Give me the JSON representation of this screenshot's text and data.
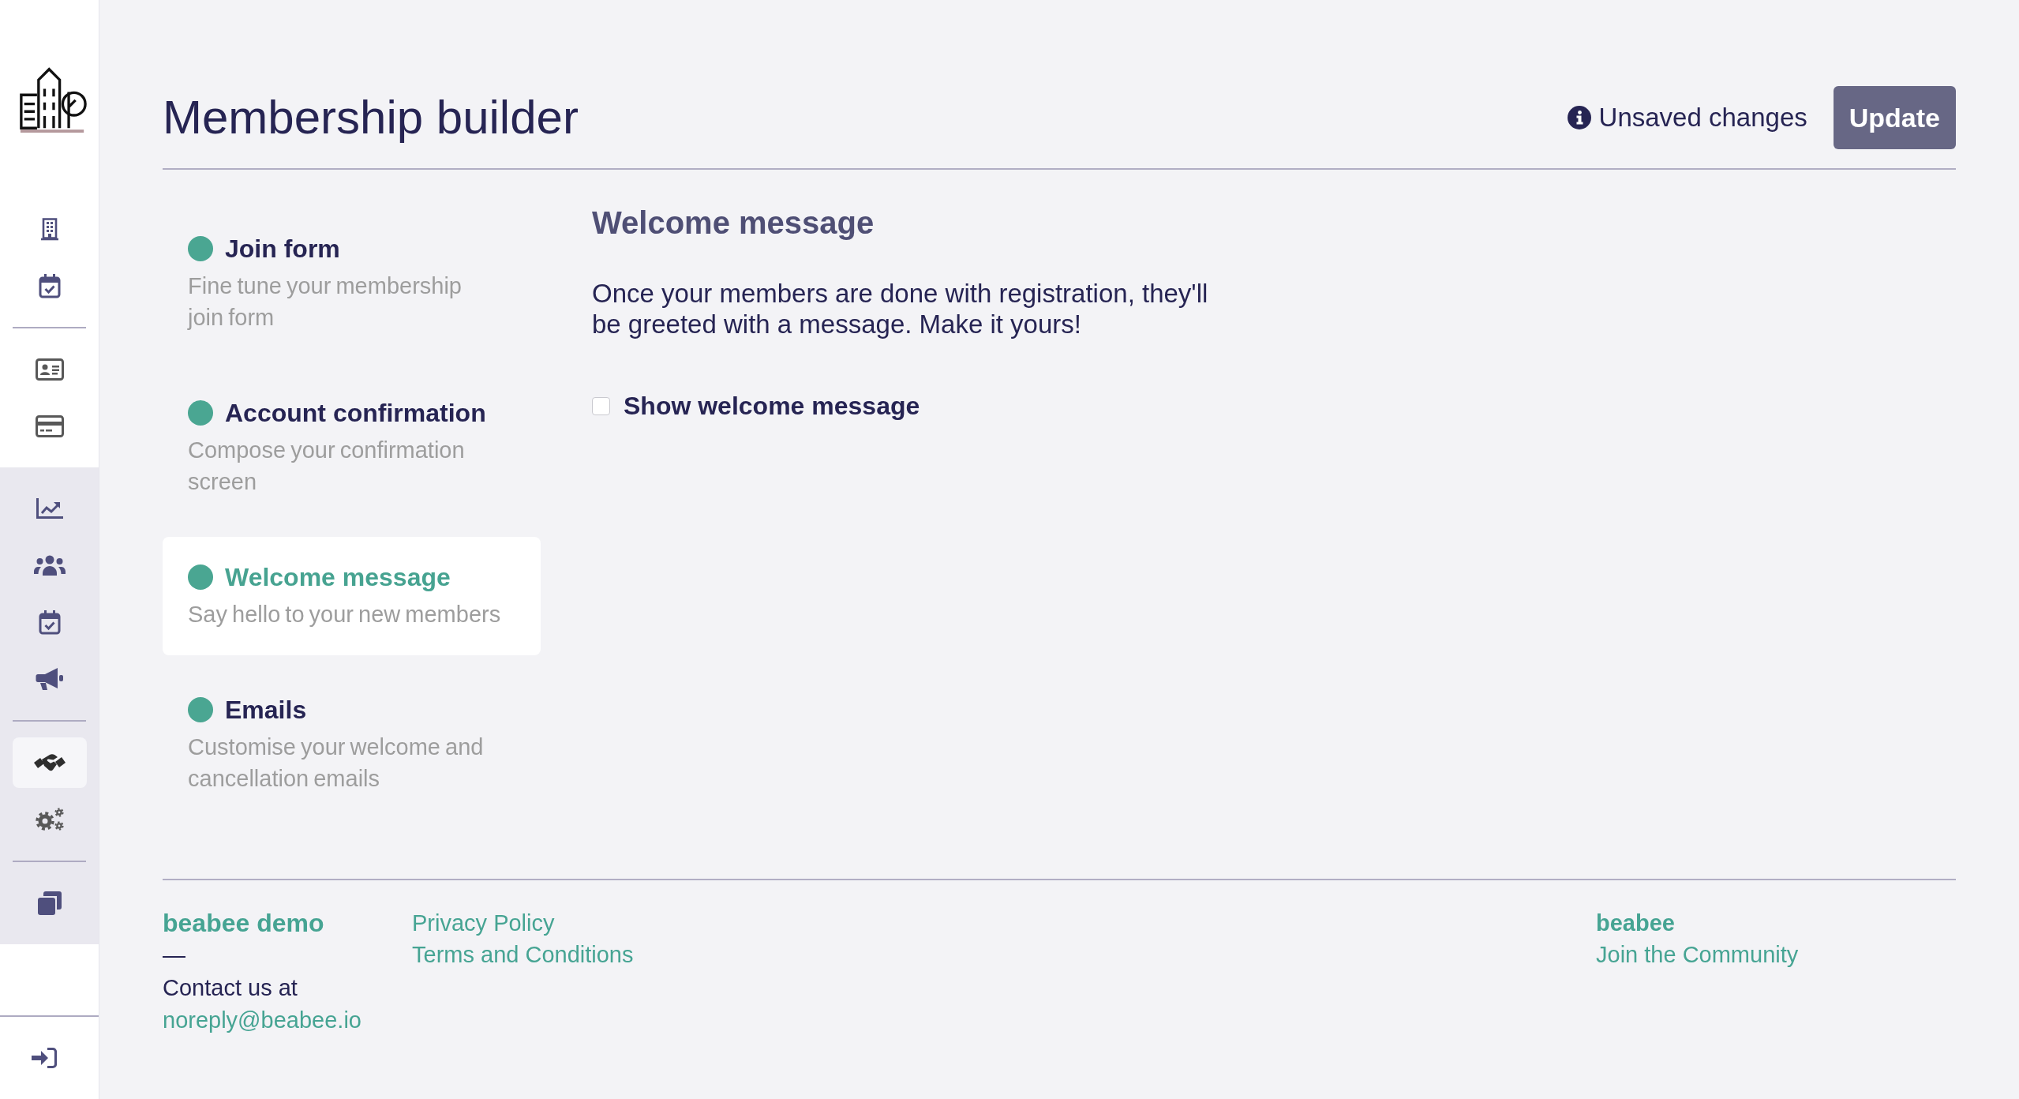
{
  "sidebar": {
    "sections": [
      {
        "shaded": false,
        "items": [
          {
            "selected": false
          },
          {
            "selected": false
          }
        ]
      },
      {
        "shaded": false,
        "items": [
          {
            "selected": false
          },
          {
            "selected": false
          }
        ]
      },
      {
        "shaded": true,
        "items": [
          {
            "selected": false
          },
          {
            "selected": false
          },
          {
            "selected": false
          },
          {
            "selected": false
          }
        ]
      },
      {
        "shaded": true,
        "items": [
          {
            "selected": true
          },
          {
            "selected": false
          }
        ]
      },
      {
        "shaded": true,
        "items": [
          {
            "selected": false
          }
        ]
      }
    ],
    "bottom_items": [
      {
        "selected": false
      }
    ]
  },
  "header": {
    "title": "Membership builder",
    "status": "Unsaved changes",
    "update_button": "Update"
  },
  "steps": [
    {
      "title": "Join form",
      "description": "Fine tune your membership join form",
      "selected": false
    },
    {
      "title": "Account confirmation",
      "description": "Compose your confirmation screen",
      "selected": false
    },
    {
      "title": "Welcome message",
      "description": "Say hello to your new members",
      "selected": true
    },
    {
      "title": "Emails",
      "description": "Customise your welcome and cancellation emails",
      "selected": false
    }
  ],
  "content": {
    "heading": "Welcome message",
    "text": "Once your members are done with registration, they'll be greeted with a message. Make it yours!",
    "checkbox": {
      "label": "Show welcome message",
      "checked": false
    }
  },
  "footer": {
    "org_name": "beabee demo",
    "separator": "—",
    "contact_label": "Contact us at",
    "email": "noreply@beabee.io",
    "links": [
      "Privacy Policy",
      "Terms and Conditions"
    ],
    "brand": "beabee",
    "community_link": "Join the Community"
  }
}
